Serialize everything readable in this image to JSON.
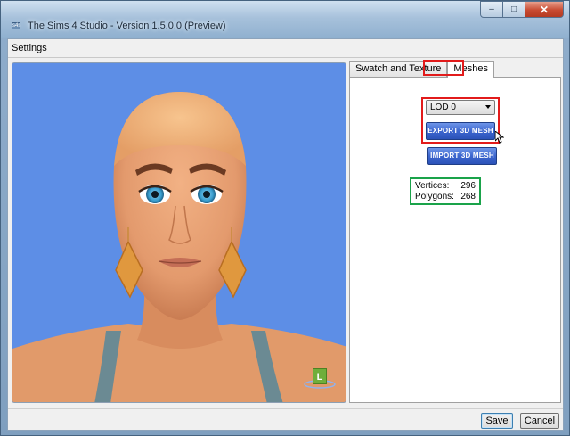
{
  "window": {
    "title": "The Sims 4 Studio - Version 1.5.0.0 (Preview)",
    "app_icon_text": "s4s",
    "buttons": {
      "minimize": "–",
      "maximize": "□",
      "close": "✕"
    }
  },
  "menu": {
    "settings_label": "Settings"
  },
  "viewport": {
    "badge_label": "L",
    "background_color": "#5d8ee6"
  },
  "tabs": [
    {
      "label": "Swatch and Texture",
      "active": false
    },
    {
      "label": "Meshes",
      "active": true
    }
  ],
  "meshes": {
    "lod_select_value": "LOD 0",
    "export_button": "EXPORT 3D MESH",
    "import_button": "IMPORT 3D MESH",
    "stats": [
      {
        "label": "Vertices:",
        "value": "296"
      },
      {
        "label": "Polygons:",
        "value": "268"
      }
    ]
  },
  "footer": {
    "save_label": "Save",
    "cancel_label": "Cancel"
  },
  "colors": {
    "highlight_red": "#e21b1b",
    "highlight_green": "#1aa34a",
    "button_blue": "#3c66cf"
  }
}
